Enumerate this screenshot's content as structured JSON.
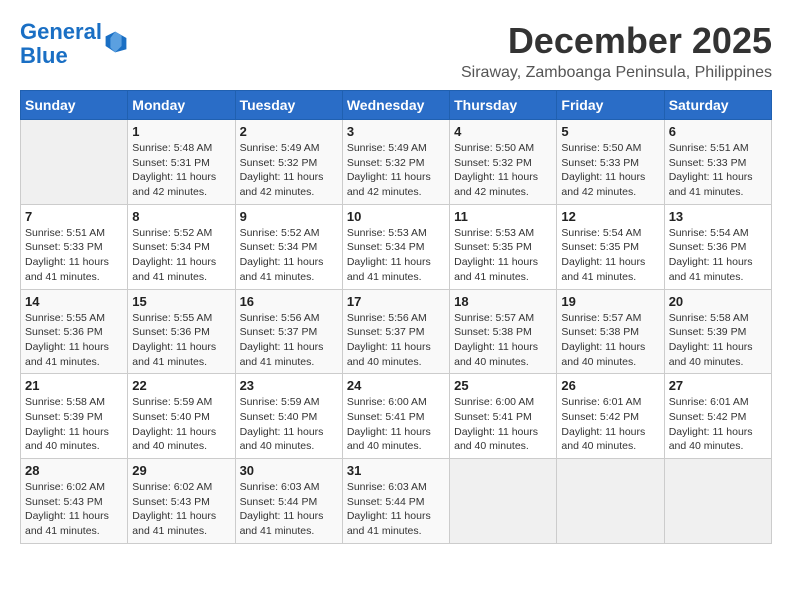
{
  "logo": {
    "line1": "General",
    "line2": "Blue"
  },
  "title": "December 2025",
  "location": "Siraway, Zamboanga Peninsula, Philippines",
  "weekdays": [
    "Sunday",
    "Monday",
    "Tuesday",
    "Wednesday",
    "Thursday",
    "Friday",
    "Saturday"
  ],
  "weeks": [
    [
      {
        "day": "",
        "info": ""
      },
      {
        "day": "1",
        "info": "Sunrise: 5:48 AM\nSunset: 5:31 PM\nDaylight: 11 hours\nand 42 minutes."
      },
      {
        "day": "2",
        "info": "Sunrise: 5:49 AM\nSunset: 5:32 PM\nDaylight: 11 hours\nand 42 minutes."
      },
      {
        "day": "3",
        "info": "Sunrise: 5:49 AM\nSunset: 5:32 PM\nDaylight: 11 hours\nand 42 minutes."
      },
      {
        "day": "4",
        "info": "Sunrise: 5:50 AM\nSunset: 5:32 PM\nDaylight: 11 hours\nand 42 minutes."
      },
      {
        "day": "5",
        "info": "Sunrise: 5:50 AM\nSunset: 5:33 PM\nDaylight: 11 hours\nand 42 minutes."
      },
      {
        "day": "6",
        "info": "Sunrise: 5:51 AM\nSunset: 5:33 PM\nDaylight: 11 hours\nand 41 minutes."
      }
    ],
    [
      {
        "day": "7",
        "info": "Sunrise: 5:51 AM\nSunset: 5:33 PM\nDaylight: 11 hours\nand 41 minutes."
      },
      {
        "day": "8",
        "info": "Sunrise: 5:52 AM\nSunset: 5:34 PM\nDaylight: 11 hours\nand 41 minutes."
      },
      {
        "day": "9",
        "info": "Sunrise: 5:52 AM\nSunset: 5:34 PM\nDaylight: 11 hours\nand 41 minutes."
      },
      {
        "day": "10",
        "info": "Sunrise: 5:53 AM\nSunset: 5:34 PM\nDaylight: 11 hours\nand 41 minutes."
      },
      {
        "day": "11",
        "info": "Sunrise: 5:53 AM\nSunset: 5:35 PM\nDaylight: 11 hours\nand 41 minutes."
      },
      {
        "day": "12",
        "info": "Sunrise: 5:54 AM\nSunset: 5:35 PM\nDaylight: 11 hours\nand 41 minutes."
      },
      {
        "day": "13",
        "info": "Sunrise: 5:54 AM\nSunset: 5:36 PM\nDaylight: 11 hours\nand 41 minutes."
      }
    ],
    [
      {
        "day": "14",
        "info": "Sunrise: 5:55 AM\nSunset: 5:36 PM\nDaylight: 11 hours\nand 41 minutes."
      },
      {
        "day": "15",
        "info": "Sunrise: 5:55 AM\nSunset: 5:36 PM\nDaylight: 11 hours\nand 41 minutes."
      },
      {
        "day": "16",
        "info": "Sunrise: 5:56 AM\nSunset: 5:37 PM\nDaylight: 11 hours\nand 41 minutes."
      },
      {
        "day": "17",
        "info": "Sunrise: 5:56 AM\nSunset: 5:37 PM\nDaylight: 11 hours\nand 40 minutes."
      },
      {
        "day": "18",
        "info": "Sunrise: 5:57 AM\nSunset: 5:38 PM\nDaylight: 11 hours\nand 40 minutes."
      },
      {
        "day": "19",
        "info": "Sunrise: 5:57 AM\nSunset: 5:38 PM\nDaylight: 11 hours\nand 40 minutes."
      },
      {
        "day": "20",
        "info": "Sunrise: 5:58 AM\nSunset: 5:39 PM\nDaylight: 11 hours\nand 40 minutes."
      }
    ],
    [
      {
        "day": "21",
        "info": "Sunrise: 5:58 AM\nSunset: 5:39 PM\nDaylight: 11 hours\nand 40 minutes."
      },
      {
        "day": "22",
        "info": "Sunrise: 5:59 AM\nSunset: 5:40 PM\nDaylight: 11 hours\nand 40 minutes."
      },
      {
        "day": "23",
        "info": "Sunrise: 5:59 AM\nSunset: 5:40 PM\nDaylight: 11 hours\nand 40 minutes."
      },
      {
        "day": "24",
        "info": "Sunrise: 6:00 AM\nSunset: 5:41 PM\nDaylight: 11 hours\nand 40 minutes."
      },
      {
        "day": "25",
        "info": "Sunrise: 6:00 AM\nSunset: 5:41 PM\nDaylight: 11 hours\nand 40 minutes."
      },
      {
        "day": "26",
        "info": "Sunrise: 6:01 AM\nSunset: 5:42 PM\nDaylight: 11 hours\nand 40 minutes."
      },
      {
        "day": "27",
        "info": "Sunrise: 6:01 AM\nSunset: 5:42 PM\nDaylight: 11 hours\nand 40 minutes."
      }
    ],
    [
      {
        "day": "28",
        "info": "Sunrise: 6:02 AM\nSunset: 5:43 PM\nDaylight: 11 hours\nand 41 minutes."
      },
      {
        "day": "29",
        "info": "Sunrise: 6:02 AM\nSunset: 5:43 PM\nDaylight: 11 hours\nand 41 minutes."
      },
      {
        "day": "30",
        "info": "Sunrise: 6:03 AM\nSunset: 5:44 PM\nDaylight: 11 hours\nand 41 minutes."
      },
      {
        "day": "31",
        "info": "Sunrise: 6:03 AM\nSunset: 5:44 PM\nDaylight: 11 hours\nand 41 minutes."
      },
      {
        "day": "",
        "info": ""
      },
      {
        "day": "",
        "info": ""
      },
      {
        "day": "",
        "info": ""
      }
    ]
  ]
}
